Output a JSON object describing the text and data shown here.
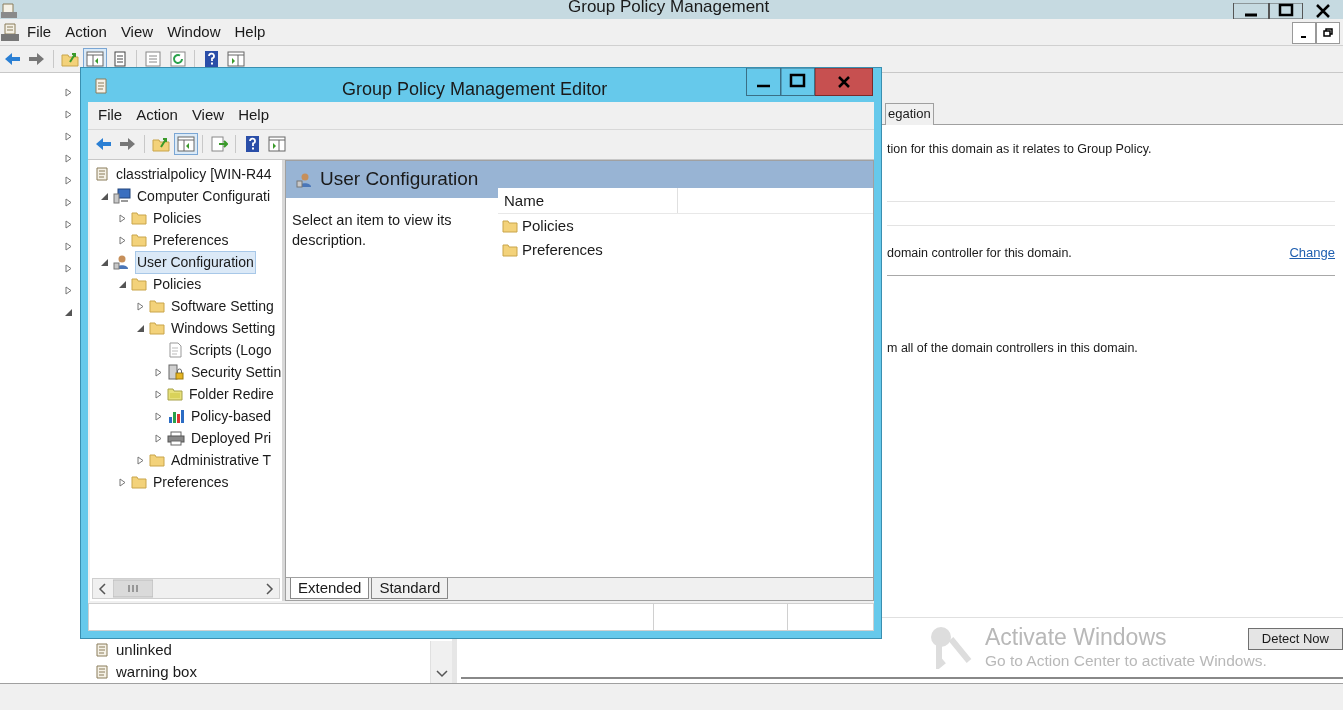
{
  "main_window": {
    "title": "Group Policy Management",
    "menu": [
      "File",
      "Action",
      "View",
      "Window",
      "Help"
    ],
    "toolbar": [
      {
        "kind": "back",
        "pressed": false
      },
      {
        "kind": "forward",
        "pressed": false
      },
      {
        "kind": "sep"
      },
      {
        "kind": "up",
        "pressed": false
      },
      {
        "kind": "tree",
        "pressed": true
      },
      {
        "kind": "clipboard",
        "pressed": false
      },
      {
        "kind": "sep"
      },
      {
        "kind": "properties",
        "pressed": false
      },
      {
        "kind": "refresh",
        "pressed": false
      },
      {
        "kind": "sep"
      },
      {
        "kind": "help",
        "pressed": false
      },
      {
        "kind": "pane",
        "pressed": false
      }
    ],
    "tree": {
      "hidden_rows": [
        {
          "expanded": false
        },
        {
          "expanded": false
        },
        {
          "expanded": false
        },
        {
          "expanded": false
        },
        {
          "expanded": false
        },
        {
          "expanded": false
        },
        {
          "expanded": false
        },
        {
          "expanded": false
        },
        {
          "expanded": false
        },
        {
          "expanded": false
        },
        {
          "expanded": true
        }
      ],
      "items": [
        {
          "label": "unlinked"
        },
        {
          "label": "warning box"
        }
      ]
    },
    "details": {
      "tab": "egation",
      "lines": [
        {
          "kind": "text",
          "text": "tion for this domain as it relates to Group Policy."
        },
        {
          "kind": "rule"
        },
        {
          "kind": "text",
          "text": "domain controller for this domain.",
          "link": "Change"
        },
        {
          "kind": "rule"
        },
        {
          "kind": "text",
          "text": "m all of the domain controllers in this domain."
        }
      ],
      "button": "Detect Now"
    },
    "activation_notice": {
      "title": "Activate Windows",
      "message": "Go to Action Center to activate Windows."
    }
  },
  "editor_window": {
    "title": "Group Policy Management Editor",
    "menu": [
      "File",
      "Action",
      "View",
      "Help"
    ],
    "toolbar": [
      {
        "kind": "back",
        "pressed": false
      },
      {
        "kind": "forward",
        "pressed": false
      },
      {
        "kind": "sep"
      },
      {
        "kind": "up",
        "pressed": false
      },
      {
        "kind": "tree",
        "pressed": true
      },
      {
        "kind": "sep"
      },
      {
        "kind": "export",
        "pressed": false
      },
      {
        "kind": "sep"
      },
      {
        "kind": "help",
        "pressed": false
      },
      {
        "kind": "pane",
        "pressed": false
      }
    ],
    "tree": [
      {
        "label": "classtrialpolicy [WIN-R44",
        "kind": "gpo",
        "selected": false,
        "children": [
          {
            "label": "Computer Configurati",
            "kind": "computer",
            "expanded": true,
            "selected": false,
            "children": [
              {
                "label": "Policies",
                "kind": "folder",
                "expanded": false,
                "selected": false
              },
              {
                "label": "Preferences",
                "kind": "folder",
                "expanded": false,
                "selected": false
              }
            ]
          },
          {
            "label": "User Configuration",
            "kind": "user",
            "expanded": true,
            "selected": true,
            "children": [
              {
                "label": "Policies",
                "kind": "folder",
                "expanded": true,
                "selected": false,
                "children": [
                  {
                    "label": "Software Setting",
                    "kind": "folder",
                    "expanded": false,
                    "selected": false
                  },
                  {
                    "label": "Windows Setting",
                    "kind": "folder",
                    "expanded": true,
                    "selected": false,
                    "children": [
                      {
                        "label": "Scripts (Logo",
                        "kind": "script",
                        "selected": false
                      },
                      {
                        "label": "Security Settin",
                        "kind": "security",
                        "expanded": false,
                        "selected": false
                      },
                      {
                        "label": "Folder Redire",
                        "kind": "redirect",
                        "expanded": false,
                        "selected": false
                      },
                      {
                        "label": "Policy-based",
                        "kind": "chart",
                        "expanded": false,
                        "selected": false
                      },
                      {
                        "label": "Deployed Pri",
                        "kind": "printer",
                        "expanded": false,
                        "selected": false
                      }
                    ]
                  },
                  {
                    "label": "Administrative T",
                    "kind": "folder",
                    "expanded": false,
                    "selected": false
                  }
                ]
              },
              {
                "label": "Preferences",
                "kind": "folder",
                "expanded": false,
                "selected": false
              }
            ]
          }
        ]
      }
    ],
    "pane_title": "User Configuration",
    "description": "Select an item to view its description.",
    "list": {
      "columns": [
        "Name"
      ],
      "rows": [
        {
          "name": "Policies"
        },
        {
          "name": "Preferences"
        }
      ]
    },
    "tabs": [
      {
        "label": "Extended",
        "selected": true
      },
      {
        "label": "Standard",
        "selected": false
      }
    ]
  }
}
